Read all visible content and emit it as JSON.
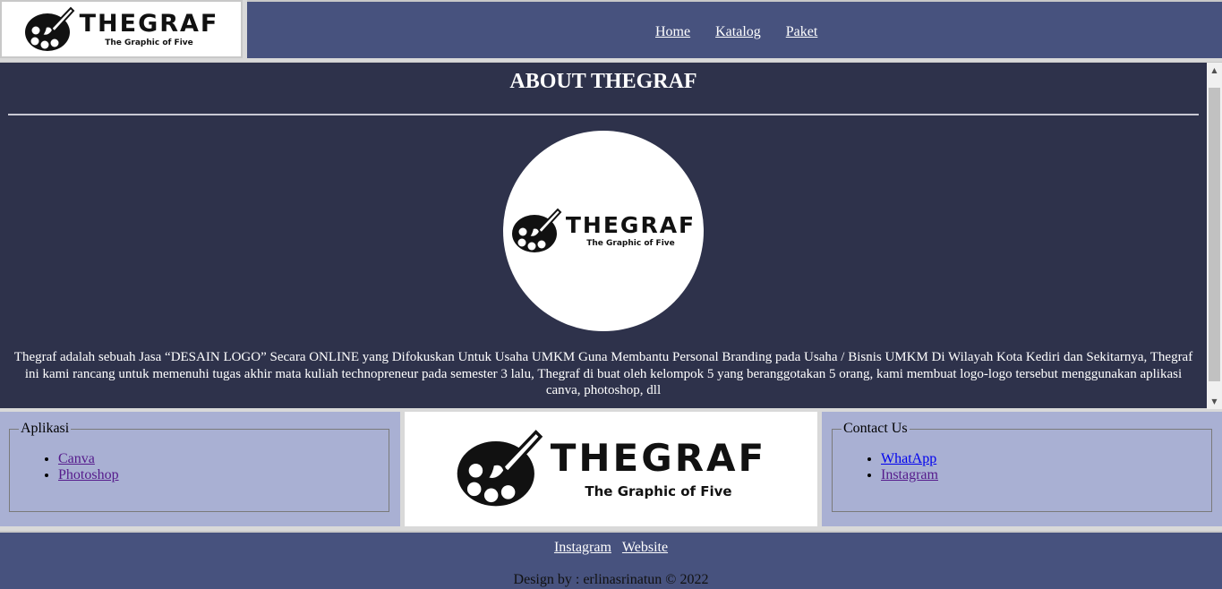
{
  "brand": {
    "name": "THEGRAF",
    "tagline": "The Graphic of Five"
  },
  "nav": {
    "items": [
      "Home",
      "Katalog",
      "Paket"
    ]
  },
  "about": {
    "title": "ABOUT THEGRAF",
    "text": "Thegraf adalah sebuah Jasa “DESAIN LOGO” Secara ONLINE yang Difokuskan Untuk Usaha UMKM Guna Membantu Personal Branding pada Usaha / Bisnis UMKM Di Wilayah Kota Kediri dan Sekitarnya, Thegraf ini kami rancang untuk memenuhi tugas akhir mata kuliah technopreneur pada semester 3 lalu, Thegraf di buat oleh kelompok 5 yang beranggotakan 5 orang, kami membuat logo-logo tersebut menggunakan aplikasi canva, photoshop, dll"
  },
  "aplikasi": {
    "legend": "Aplikasi",
    "items": [
      "Canva",
      "Photoshop"
    ]
  },
  "contact": {
    "legend": "Contact Us",
    "items": [
      "WhatApp",
      "Instagram"
    ]
  },
  "footer": {
    "links": [
      "Instagram",
      "Website"
    ],
    "credit": "Design by : erlinasrinatun © 2022"
  },
  "colors": {
    "header_bg": "#47527e",
    "main_bg": "#2e324b",
    "panel_bg": "#a9b0d3"
  },
  "icons": {
    "logo": "palette-brush-icon",
    "scroll_up": "triangle-up-icon",
    "scroll_down": "triangle-down-icon"
  }
}
